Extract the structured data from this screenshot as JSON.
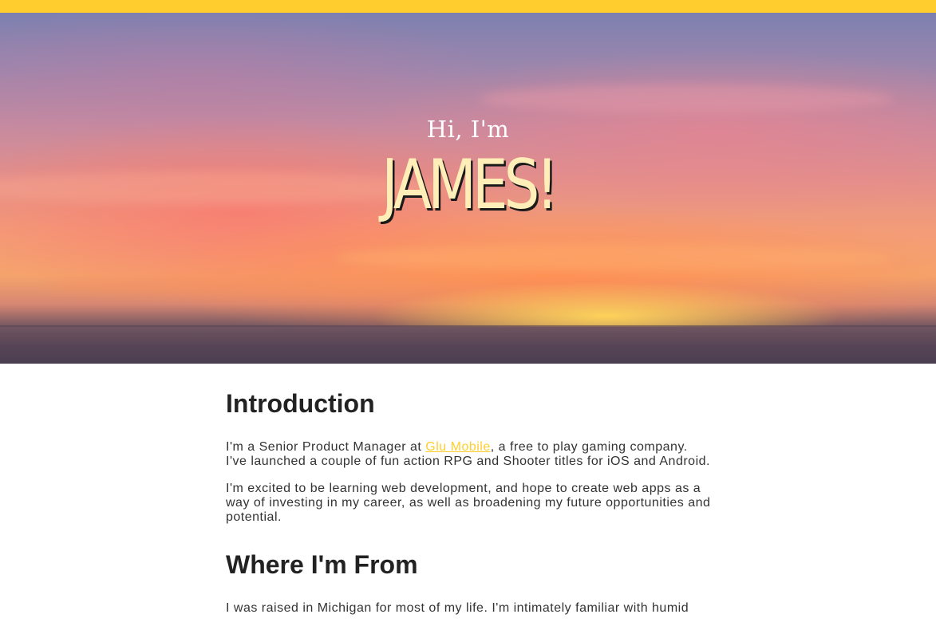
{
  "hero": {
    "greeting": "Hi, I'm",
    "name": "JAMES!"
  },
  "sections": [
    {
      "heading": "Introduction",
      "paragraphs": [
        {
          "before_link": "I'm a Senior Product Manager at ",
          "link_text": "Glu Mobile",
          "after_link": ", a free to play gaming company. I've launched a couple of fun action RPG and Shooter titles for iOS and Android."
        },
        {
          "text": "I'm excited to be learning web development, and hope to create web apps as a way of investing in my career, as well as broadening my future opportunities and potential."
        }
      ]
    },
    {
      "heading": "Where I'm From",
      "paragraphs": [
        {
          "text": "I was raised in Michigan for most of my life. I'm intimately familiar with humid"
        }
      ]
    }
  ],
  "colors": {
    "accent": "#ffce2e",
    "name_fill": "#ffeeb8",
    "text": "#333333",
    "heading": "#222222"
  }
}
